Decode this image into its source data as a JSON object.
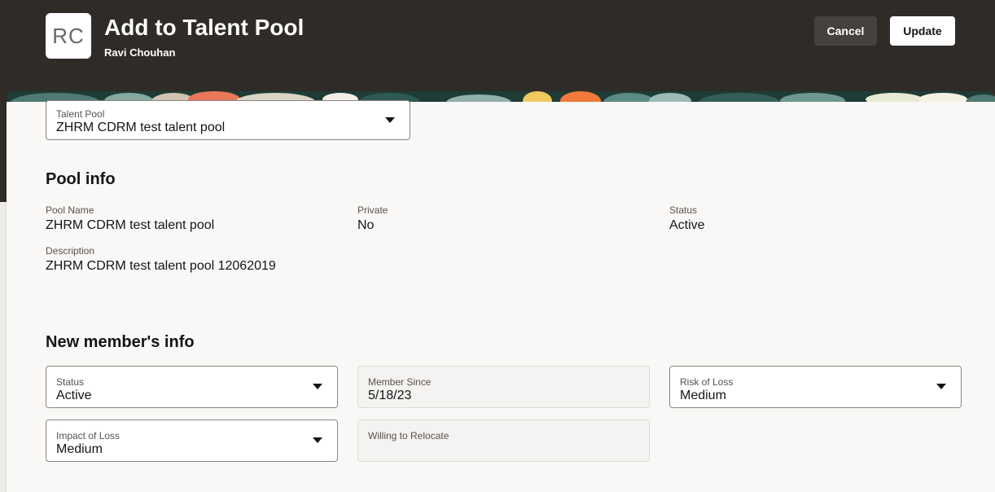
{
  "header": {
    "avatar_initials": "RC",
    "title": "Add to Talent Pool",
    "subtitle": "Ravi Chouhan",
    "cancel_label": "Cancel",
    "update_label": "Update"
  },
  "talent_pool_select": {
    "label": "Talent Pool",
    "value": "ZHRM CDRM test talent pool"
  },
  "pool_info": {
    "heading": "Pool info",
    "pool_name_label": "Pool Name",
    "pool_name_value": "ZHRM CDRM test talent pool",
    "private_label": "Private",
    "private_value": "No",
    "status_label": "Status",
    "status_value": "Active",
    "description_label": "Description",
    "description_value": "ZHRM CDRM test talent pool 12062019"
  },
  "member_info": {
    "heading": "New member's info",
    "status_label": "Status",
    "status_value": "Active",
    "member_since_label": "Member Since",
    "member_since_value": "5/18/23",
    "risk_label": "Risk of Loss",
    "risk_value": "Medium",
    "impact_label": "Impact of Loss",
    "impact_value": "Medium",
    "relocate_label": "Willing to Relocate",
    "relocate_value": ""
  },
  "colors": {
    "header_bg": "#2f2b27",
    "panel_bg": "#f9f8f6",
    "cancel_bg": "#46413c",
    "text": "#161513"
  }
}
